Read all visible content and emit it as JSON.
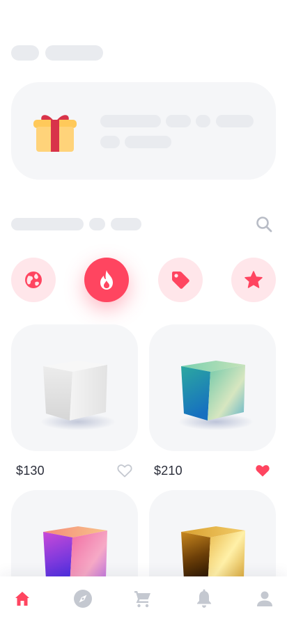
{
  "header": {
    "placeholder_pills": [
      "",
      ""
    ]
  },
  "promo_card": {
    "icon": "gift-icon",
    "placeholder_lines": [
      "",
      ""
    ]
  },
  "section": {
    "placeholder_pills": [
      "",
      "",
      ""
    ],
    "search_icon": "search-icon"
  },
  "categories": [
    {
      "icon": "globe-icon",
      "active": false
    },
    {
      "icon": "fire-icon",
      "active": true
    },
    {
      "icon": "tag-icon",
      "active": false
    },
    {
      "icon": "star-icon",
      "active": false
    }
  ],
  "products": [
    {
      "price": "$130",
      "favorite": false,
      "cube": "white-cube"
    },
    {
      "price": "$210",
      "favorite": true,
      "cube": "teal-gradient-cube"
    },
    {
      "price": "",
      "favorite": false,
      "cube": "purple-gradient-cube"
    },
    {
      "price": "",
      "favorite": false,
      "cube": "gold-cube"
    }
  ],
  "bottom_nav": [
    {
      "icon": "home-icon",
      "active": true
    },
    {
      "icon": "compass-icon",
      "active": false
    },
    {
      "icon": "cart-icon",
      "active": false
    },
    {
      "icon": "bell-icon",
      "active": false
    },
    {
      "icon": "user-icon",
      "active": false
    }
  ],
  "colors": {
    "accent": "#ff4560",
    "accent_soft": "#ffe6ea",
    "placeholder": "#e9ebef",
    "card_bg": "#f5f6f8",
    "icon_gray": "#c4c8d0",
    "text": "#2b2e3a"
  }
}
